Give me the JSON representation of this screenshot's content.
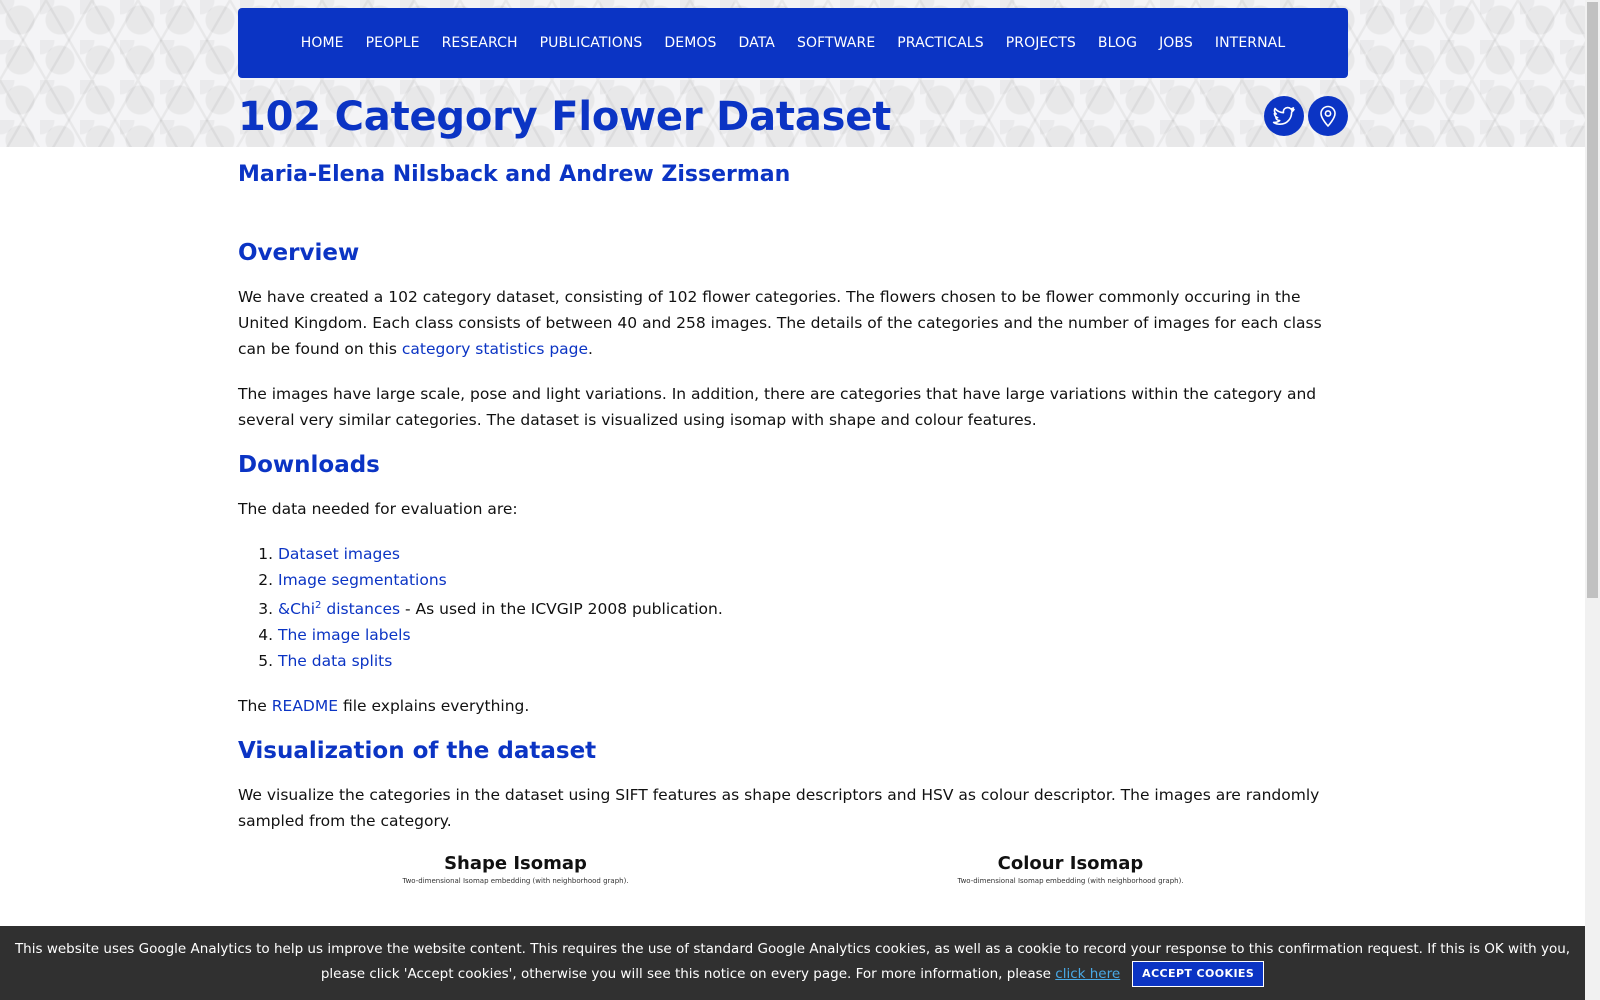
{
  "nav": {
    "items": [
      "HOME",
      "PEOPLE",
      "RESEARCH",
      "PUBLICATIONS",
      "DEMOS",
      "DATA",
      "SOFTWARE",
      "PRACTICALS",
      "PROJECTS",
      "BLOG",
      "JOBS",
      "INTERNAL"
    ]
  },
  "page": {
    "title": "102 Category Flower Dataset",
    "authors": "Maria-Elena Nilsback and Andrew Zisserman"
  },
  "social": {
    "icons": [
      "twitter-icon",
      "map-pin-icon"
    ],
    "color": "#0b34c4"
  },
  "overview": {
    "heading": "Overview",
    "p1_text": "We have created a 102 category dataset, consisting of 102 flower categories. The flowers chosen to be flower commonly occuring in the United Kingdom. Each class consists of between 40 and 258 images. The details of the categories and the number of images for each class can be found on this ",
    "p1_link": "category statistics page",
    "p1_end": ".",
    "p2": "The images have large scale, pose and light variations. In addition, there are categories that have large variations within the category and several very similar categories. The dataset is visualized using isomap with shape and colour features."
  },
  "downloads": {
    "heading": "Downloads",
    "intro": "The data needed for evaluation are:",
    "item1": "Dataset images",
    "item2": "Image segmentations",
    "item3_link": "&Chi",
    "item3_sup": "2",
    "item3_link2": " distances",
    "item3_rest": " - As used in the ICVGIP 2008 publication.",
    "item4": "The image labels",
    "item5": "The data splits",
    "readme_pre": "The ",
    "readme_link": "README",
    "readme_post": " file explains everything."
  },
  "visualization": {
    "heading": "Visualization of the dataset",
    "p": "We visualize the categories in the dataset using SIFT features as shape descriptors and HSV as colour descriptor. The images are randomly sampled from the category.",
    "shape_title": "Shape Isomap",
    "colour_title": "Colour Isomap",
    "subcaption": "Two-dimensional Isomap embedding (with neighborhood graph)."
  },
  "cookie": {
    "text": "This website uses Google Analytics to help us improve the website content. This requires the use of standard Google Analytics cookies, as well as a cookie to record your response to this confirmation request. If this is OK with you, please click 'Accept cookies', otherwise you will see this notice on every page. For more information, please ",
    "link": "click here",
    "button": "ACCEPT COOKIES"
  },
  "colors": {
    "primary": "#0b34c4",
    "cookie_bg": "#202020",
    "link_cookie": "#49a9e6"
  }
}
